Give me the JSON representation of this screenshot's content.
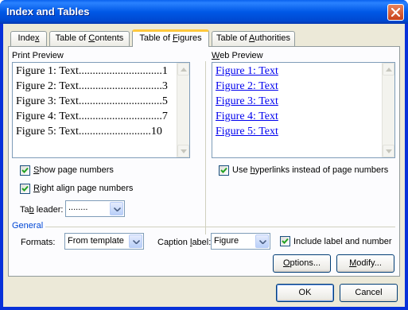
{
  "window": {
    "title": "Index and Tables"
  },
  "tabs": [
    {
      "label_pre": "Inde",
      "accel": "x",
      "label_post": ""
    },
    {
      "label_pre": "Table of ",
      "accel": "C",
      "label_post": "ontents"
    },
    {
      "label_pre": "Table of ",
      "accel": "F",
      "label_post": "igures"
    },
    {
      "label_pre": "Table of ",
      "accel": "A",
      "label_post": "uthorities"
    }
  ],
  "active_tab": "Table of Figures",
  "print_preview": {
    "label": "Print Preview",
    "entries": [
      {
        "text": "Figure 1: Text",
        "dots": "..............................",
        "page": "1"
      },
      {
        "text": "Figure 2: Text",
        "dots": "..............................",
        "page": "3"
      },
      {
        "text": "Figure 3: Text",
        "dots": "..............................",
        "page": "5"
      },
      {
        "text": "Figure 4: Text",
        "dots": "..............................",
        "page": "7"
      },
      {
        "text": "Figure 5: Text",
        "dots": "..........................",
        "page": "10"
      }
    ]
  },
  "web_preview": {
    "label_pre": "",
    "accel": "W",
    "label_post": "eb Preview",
    "entries": [
      "Figure 1: Text",
      "Figure 2: Text",
      "Figure 3: Text",
      "Figure 4: Text",
      "Figure 5: Text"
    ]
  },
  "options": {
    "show_page_numbers": {
      "pre": "",
      "accel": "S",
      "post": "how page numbers",
      "checked": true
    },
    "right_align": {
      "pre": "",
      "accel": "R",
      "post": "ight align page numbers",
      "checked": true
    },
    "use_hyperlinks": {
      "pre": "Use ",
      "accel": "h",
      "post": "yperlinks instead of page numbers",
      "checked": true
    },
    "tab_leader": {
      "pre": "Ta",
      "accel": "b",
      "post": " leader:",
      "value": "........"
    }
  },
  "general": {
    "label": "General",
    "formats": {
      "pre": "Formats:",
      "accel": "",
      "post": "",
      "value": "From template"
    },
    "caption_label": {
      "pre": "Caption ",
      "accel": "l",
      "post": "abel:",
      "value": "Figure"
    },
    "include_label": {
      "label": "Include label and number",
      "checked": true
    }
  },
  "buttons": {
    "options": {
      "pre": "",
      "accel": "O",
      "post": "ptions..."
    },
    "modify": {
      "pre": "",
      "accel": "M",
      "post": "odify..."
    },
    "ok": "OK",
    "cancel": "Cancel"
  }
}
